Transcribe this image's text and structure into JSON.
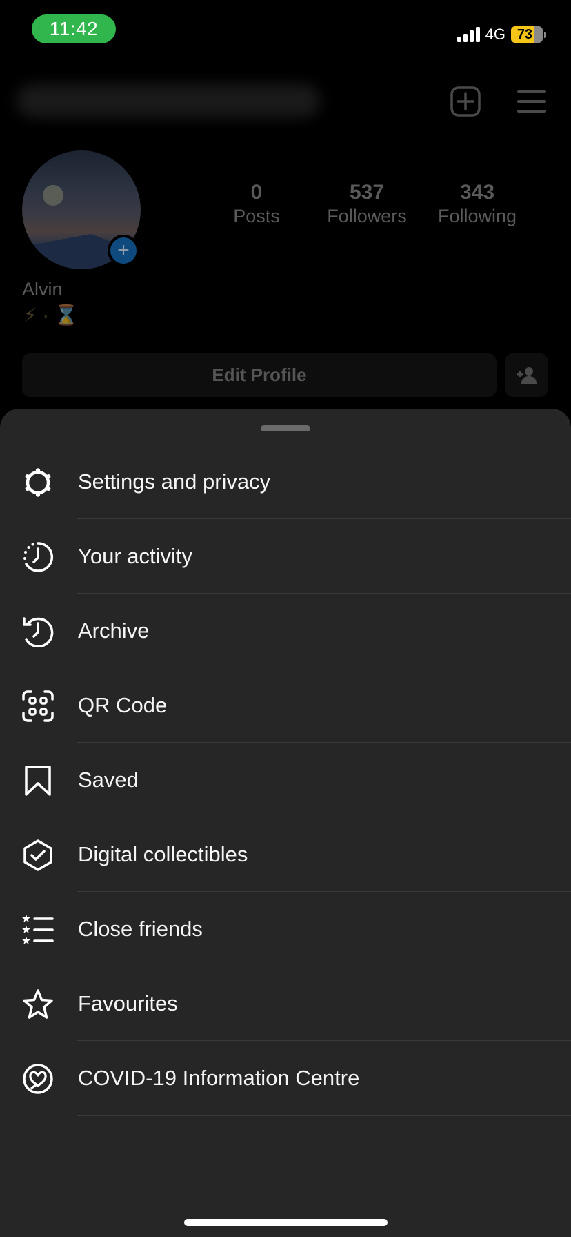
{
  "status_bar": {
    "time": "11:42",
    "network": "4G",
    "battery_percent": "73",
    "battery_level": 0.73,
    "time_pill_color": "#30b64c",
    "battery_color": "#f5c518"
  },
  "header": {
    "username_hidden": true,
    "new_post_icon": "plus-square-icon",
    "menu_icon": "hamburger-menu-icon"
  },
  "profile": {
    "name": "Alvin",
    "bio": "⚡ · ⌛",
    "stats": [
      {
        "value": "0",
        "label": "Posts"
      },
      {
        "value": "537",
        "label": "Followers"
      },
      {
        "value": "343",
        "label": "Following"
      }
    ],
    "edit_profile_label": "Edit Profile",
    "add_story_icon": "plus-icon",
    "discover_people_icon": "add-person-icon"
  },
  "menu_sheet": {
    "items": [
      {
        "label": "Settings and privacy",
        "icon": "settings-icon"
      },
      {
        "label": "Your activity",
        "icon": "activity-icon"
      },
      {
        "label": "Archive",
        "icon": "archive-icon"
      },
      {
        "label": "QR Code",
        "icon": "qr-code-icon"
      },
      {
        "label": "Saved",
        "icon": "bookmark-icon"
      },
      {
        "label": "Digital collectibles",
        "icon": "collectibles-icon"
      },
      {
        "label": "Close friends",
        "icon": "close-friends-icon"
      },
      {
        "label": "Favourites",
        "icon": "star-icon"
      },
      {
        "label": "COVID-19 Information Centre",
        "icon": "covid-info-icon"
      }
    ]
  }
}
